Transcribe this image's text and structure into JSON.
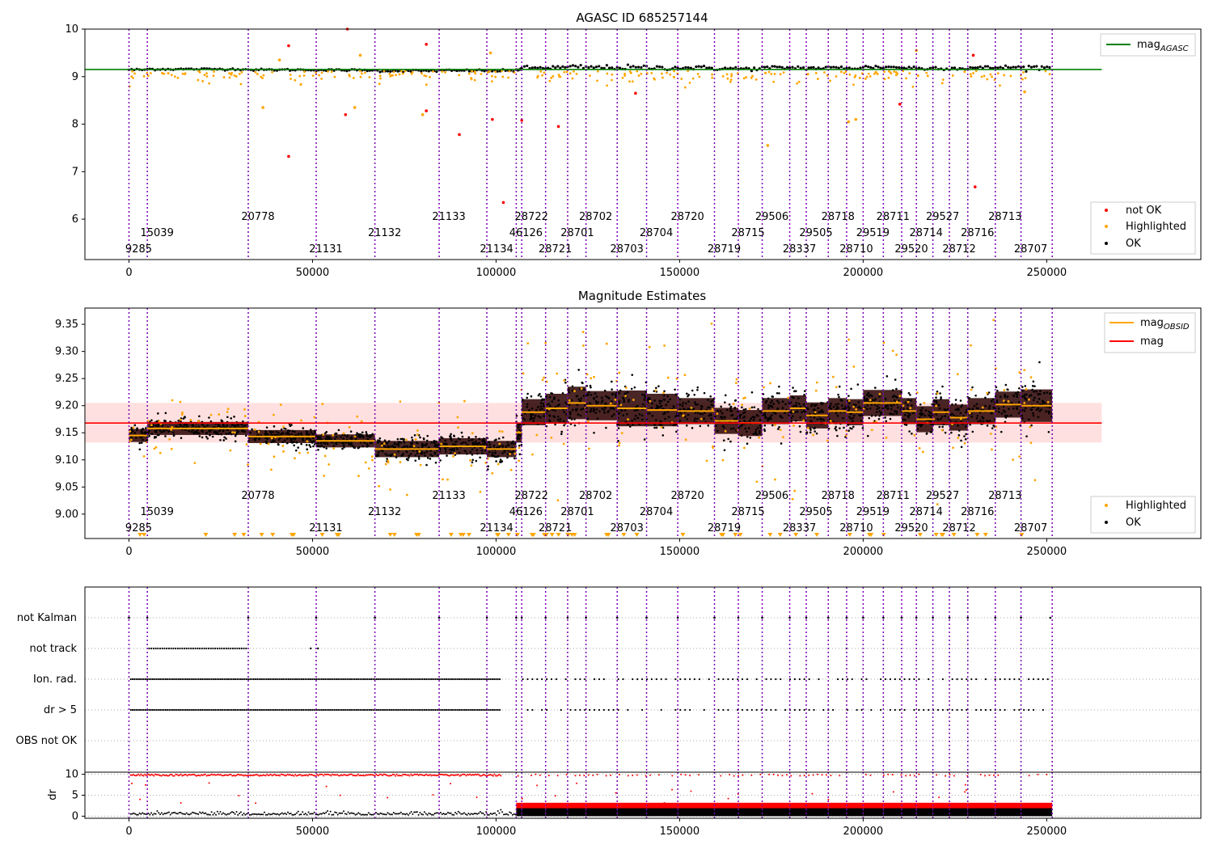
{
  "chart_data": [
    {
      "type": "scatter",
      "title": "AGASC ID 685257144",
      "xlim": [
        -12000,
        292000
      ],
      "ylim": [
        5.15,
        10.0
      ],
      "xticks": [
        "0",
        "50000",
        "100000",
        "150000",
        "200000",
        "250000"
      ],
      "yticks": [
        "6",
        "7",
        "8",
        "9",
        "10"
      ],
      "reference_line": {
        "name": "mag",
        "subscript": "AGASC",
        "value": 9.15,
        "x_range": [
          0,
          265000
        ],
        "color": "#008000"
      },
      "series": [
        {
          "name": "not OK",
          "color": "#ff0000"
        },
        {
          "name": "Highlighted",
          "color": "#ffa500"
        },
        {
          "name": "OK",
          "color": "#000000"
        }
      ],
      "outliers": [
        {
          "x": 43500,
          "y": 9.65,
          "status": "not OK"
        },
        {
          "x": 43500,
          "y": 7.32,
          "status": "not OK"
        },
        {
          "x": 59000,
          "y": 8.2,
          "status": "not OK"
        },
        {
          "x": 59500,
          "y": 10.0,
          "status": "not OK"
        },
        {
          "x": 81000,
          "y": 9.68,
          "status": "not OK"
        },
        {
          "x": 81000,
          "y": 8.28,
          "status": "not OK"
        },
        {
          "x": 90000,
          "y": 7.78,
          "status": "not OK"
        },
        {
          "x": 99000,
          "y": 8.1,
          "status": "not OK"
        },
        {
          "x": 102000,
          "y": 6.35,
          "status": "not OK"
        },
        {
          "x": 107000,
          "y": 8.08,
          "status": "not OK"
        },
        {
          "x": 117000,
          "y": 7.95,
          "status": "not OK"
        },
        {
          "x": 138000,
          "y": 8.65,
          "status": "not OK"
        },
        {
          "x": 210000,
          "y": 8.42,
          "status": "not OK"
        },
        {
          "x": 230000,
          "y": 9.45,
          "status": "not OK"
        },
        {
          "x": 230500,
          "y": 6.68,
          "status": "not OK"
        },
        {
          "x": 41000,
          "y": 9.35,
          "status": "Highlighted"
        },
        {
          "x": 36500,
          "y": 8.35,
          "status": "Highlighted"
        },
        {
          "x": 61500,
          "y": 8.35,
          "status": "Highlighted"
        },
        {
          "x": 63000,
          "y": 9.45,
          "status": "Highlighted"
        },
        {
          "x": 80000,
          "y": 8.2,
          "status": "Highlighted"
        },
        {
          "x": 98500,
          "y": 9.5,
          "status": "Highlighted"
        },
        {
          "x": 174000,
          "y": 7.55,
          "status": "Highlighted"
        },
        {
          "x": 196000,
          "y": 8.05,
          "status": "Highlighted"
        },
        {
          "x": 198000,
          "y": 8.1,
          "status": "Highlighted"
        },
        {
          "x": 214500,
          "y": 9.55,
          "status": "Highlighted"
        },
        {
          "x": 244000,
          "y": 8.68,
          "status": "Highlighted"
        }
      ],
      "legend_top": "top-right",
      "legend_bottom": "bottom-right"
    },
    {
      "type": "scatter",
      "title": "Magnitude Estimates",
      "xlim": [
        -12000,
        292000
      ],
      "ylim": [
        8.955,
        9.38
      ],
      "xticks": [
        "0",
        "50000",
        "100000",
        "150000",
        "200000",
        "250000"
      ],
      "yticks": [
        "9.00",
        "9.05",
        "9.10",
        "9.15",
        "9.20",
        "9.25",
        "9.30",
        "9.35"
      ],
      "mean": {
        "name": "mag",
        "value": 9.168,
        "band": [
          9.132,
          9.205
        ],
        "x_range": [
          0,
          265000
        ],
        "color": "#ff0000"
      },
      "segments_legend": {
        "name": "mag",
        "subscript": "OBSID",
        "color": "#ffa500"
      },
      "series": [
        {
          "name": "Highlighted",
          "color": "#ffa500"
        },
        {
          "name": "OK",
          "color": "#000000"
        }
      ],
      "legend_top": "top-right",
      "legend_bottom": "bottom-right"
    },
    {
      "type": "scatter",
      "categories": [
        "not Kalman",
        "not track",
        "Ion. rad.",
        "dr > 5",
        "OBS not OK"
      ],
      "xlim": [
        -12000,
        292000
      ],
      "xticks": [
        "0",
        "50000",
        "100000",
        "150000",
        "200000",
        "250000"
      ]
    },
    {
      "type": "scatter",
      "ylabel": "dr",
      "xlim": [
        -12000,
        292000
      ],
      "ylim": [
        -0.5,
        10.5
      ],
      "yticks": [
        "0",
        "5",
        "10"
      ],
      "xticks": [
        "0",
        "50000",
        "100000",
        "150000",
        "200000",
        "250000"
      ]
    }
  ],
  "observations": [
    {
      "id": "9285",
      "start": 0,
      "end": 5000,
      "row": 2,
      "mag": 9.145,
      "spread": 0.02
    },
    {
      "id": "15039",
      "start": 5000,
      "end": 32500,
      "row": 1,
      "mag": 9.158,
      "spread": 0.02
    },
    {
      "id": "20778",
      "start": 32500,
      "end": 51000,
      "row": 0,
      "mag": 9.143,
      "spread": 0.02
    },
    {
      "id": "21131",
      "start": 51000,
      "end": 67000,
      "row": 2,
      "mag": 9.135,
      "spread": 0.02
    },
    {
      "id": "21132",
      "start": 67000,
      "end": 84500,
      "row": 1,
      "mag": 9.12,
      "spread": 0.025
    },
    {
      "id": "21133",
      "start": 84500,
      "end": 97500,
      "row": 0,
      "mag": 9.125,
      "spread": 0.025
    },
    {
      "id": "21134",
      "start": 97500,
      "end": 105500,
      "row": 2,
      "mag": 9.12,
      "spread": 0.025
    },
    {
      "id": "46126",
      "start": 105500,
      "end": 107000,
      "row": 1,
      "mag": 9.15,
      "spread": 0.03
    },
    {
      "id": "28722",
      "start": 107000,
      "end": 113500,
      "row": 0,
      "mag": 9.188,
      "spread": 0.04
    },
    {
      "id": "28721",
      "start": 113500,
      "end": 119500,
      "row": 2,
      "mag": 9.195,
      "spread": 0.045
    },
    {
      "id": "28701",
      "start": 119500,
      "end": 124500,
      "row": 1,
      "mag": 9.205,
      "spread": 0.05
    },
    {
      "id": "28702",
      "start": 124500,
      "end": 133000,
      "row": 0,
      "mag": 9.2,
      "spread": 0.045
    },
    {
      "id": "28703",
      "start": 133000,
      "end": 141000,
      "row": 2,
      "mag": 9.195,
      "spread": 0.055
    },
    {
      "id": "28704",
      "start": 141000,
      "end": 149500,
      "row": 1,
      "mag": 9.192,
      "spread": 0.05
    },
    {
      "id": "28720",
      "start": 149500,
      "end": 159500,
      "row": 0,
      "mag": 9.19,
      "spread": 0.04
    },
    {
      "id": "28719",
      "start": 159500,
      "end": 166000,
      "row": 2,
      "mag": 9.172,
      "spread": 0.04
    },
    {
      "id": "28715",
      "start": 166000,
      "end": 172500,
      "row": 1,
      "mag": 9.168,
      "spread": 0.04
    },
    {
      "id": "29506",
      "start": 172500,
      "end": 180000,
      "row": 0,
      "mag": 9.19,
      "spread": 0.04
    },
    {
      "id": "28337",
      "start": 180000,
      "end": 184500,
      "row": 2,
      "mag": 9.195,
      "spread": 0.04
    },
    {
      "id": "29505",
      "start": 184500,
      "end": 190500,
      "row": 1,
      "mag": 9.182,
      "spread": 0.04
    },
    {
      "id": "28718",
      "start": 190500,
      "end": 195500,
      "row": 0,
      "mag": 9.19,
      "spread": 0.04
    },
    {
      "id": "28710",
      "start": 195500,
      "end": 200000,
      "row": 2,
      "mag": 9.188,
      "spread": 0.04
    },
    {
      "id": "29519",
      "start": 200000,
      "end": 205500,
      "row": 1,
      "mag": 9.205,
      "spread": 0.04
    },
    {
      "id": "28711",
      "start": 205500,
      "end": 210500,
      "row": 0,
      "mag": 9.205,
      "spread": 0.04
    },
    {
      "id": "29520",
      "start": 210500,
      "end": 214500,
      "row": 2,
      "mag": 9.19,
      "spread": 0.04
    },
    {
      "id": "28714",
      "start": 214500,
      "end": 219000,
      "row": 1,
      "mag": 9.175,
      "spread": 0.04
    },
    {
      "id": "29527",
      "start": 219000,
      "end": 223500,
      "row": 0,
      "mag": 9.188,
      "spread": 0.04
    },
    {
      "id": "28712",
      "start": 223500,
      "end": 228500,
      "row": 2,
      "mag": 9.178,
      "spread": 0.04
    },
    {
      "id": "28716",
      "start": 228500,
      "end": 236000,
      "row": 1,
      "mag": 9.19,
      "spread": 0.04
    },
    {
      "id": "28713",
      "start": 236000,
      "end": 243000,
      "row": 0,
      "mag": 9.202,
      "spread": 0.04
    },
    {
      "id": "28707",
      "start": 243000,
      "end": 251500,
      "row": 2,
      "mag": 9.2,
      "spread": 0.05
    }
  ],
  "colors": {
    "obs_line": "#7b00b3",
    "not_ok": "#ff0000",
    "highlighted": "#ffa500",
    "ok": "#000000",
    "agasc_line": "#008000",
    "mean_line": "#ff0000",
    "band": "#ffcccc"
  }
}
